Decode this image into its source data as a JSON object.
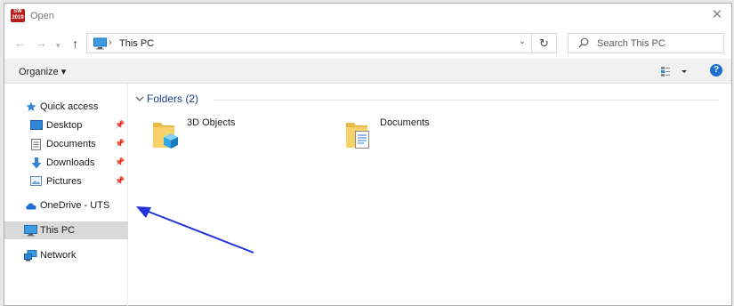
{
  "window": {
    "title": "Open",
    "app_icon_text": "SW 2019"
  },
  "nav": {
    "address": "This PC",
    "search_placeholder": "Search This PC"
  },
  "toolbar": {
    "organize_label": "Organize ▾",
    "help_label": "?"
  },
  "sidebar": {
    "items": [
      {
        "label": "Quick access",
        "icon": "star-icon",
        "pinned": false
      },
      {
        "label": "Desktop",
        "icon": "desktop-icon",
        "pinned": true
      },
      {
        "label": "Documents",
        "icon": "documents-icon",
        "pinned": true
      },
      {
        "label": "Downloads",
        "icon": "download-icon",
        "pinned": true
      },
      {
        "label": "Pictures",
        "icon": "pictures-icon",
        "pinned": true
      },
      {
        "label": "OneDrive - UTS",
        "icon": "cloud-icon",
        "pinned": false
      },
      {
        "label": "This PC",
        "icon": "computer-icon",
        "pinned": false,
        "selected": true
      },
      {
        "label": "Network",
        "icon": "network-icon",
        "pinned": false
      }
    ]
  },
  "content": {
    "group_label": "Folders (2)",
    "folders": [
      {
        "name": "3D Objects",
        "icon": "3d-objects-folder-icon"
      },
      {
        "name": "Documents",
        "icon": "documents-folder-icon"
      }
    ]
  },
  "colors": {
    "accent": "#1e6fd0",
    "annotation_arrow": "#2433d9",
    "selection": "#d9d9d9",
    "group_header": "#1d3a8a"
  }
}
